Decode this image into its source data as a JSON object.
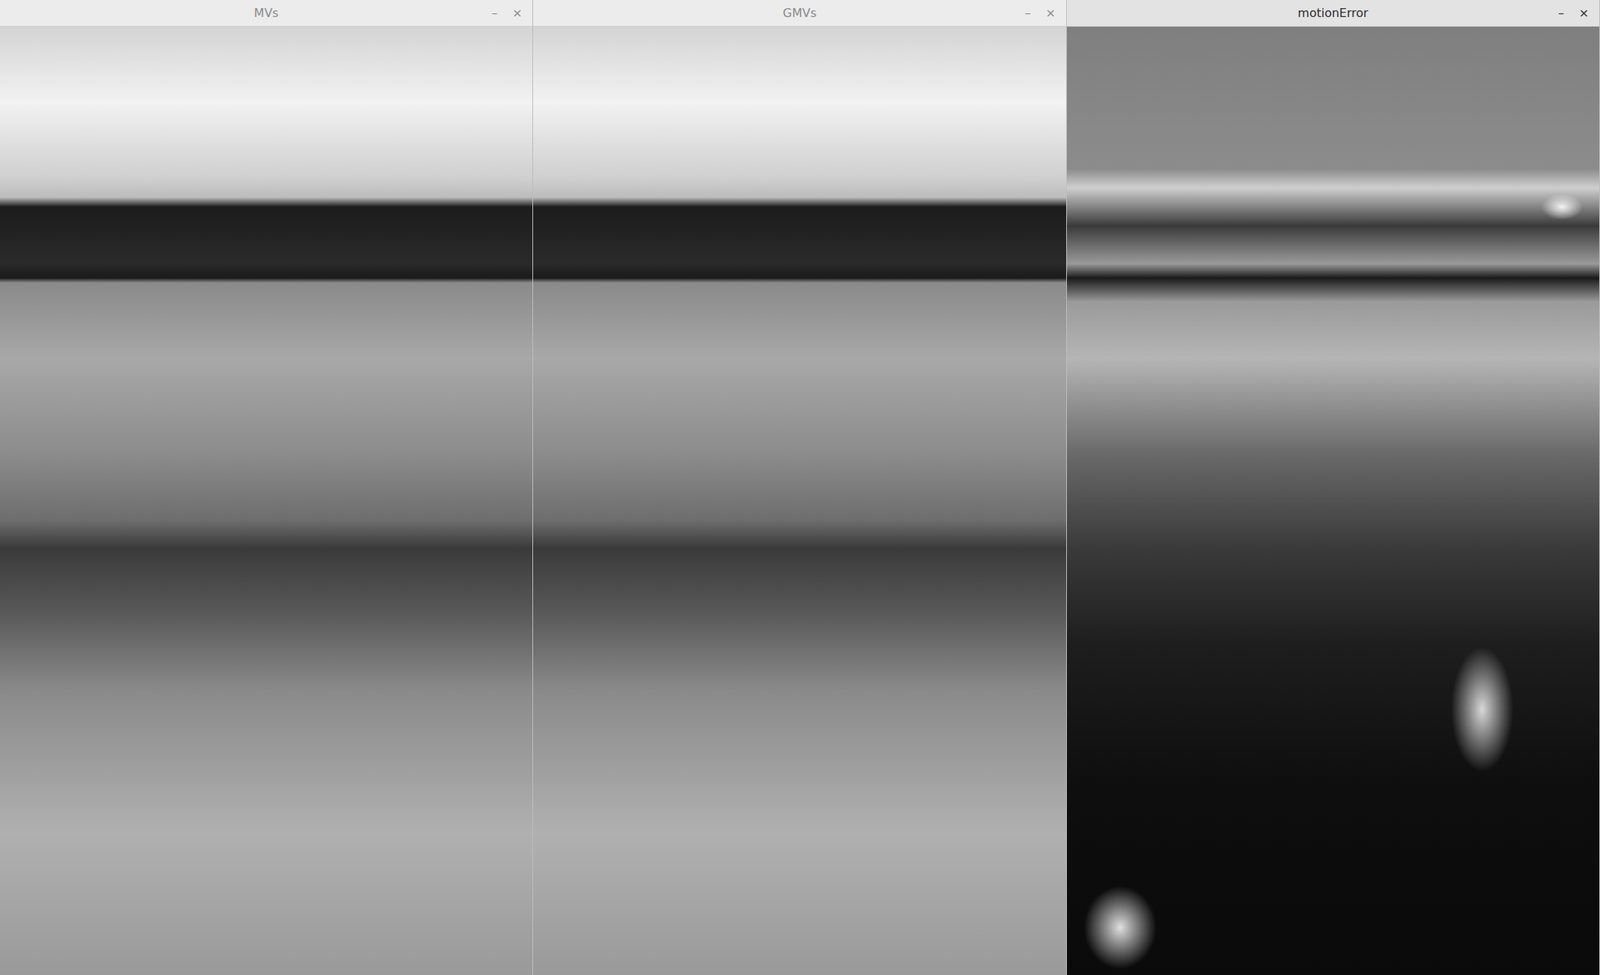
{
  "windows": [
    {
      "title": "MVs",
      "active": false,
      "kind": "photo",
      "controls": [
        "–",
        "×"
      ]
    },
    {
      "title": "GMVs",
      "active": false,
      "kind": "photo",
      "controls": [
        "–",
        "×"
      ]
    },
    {
      "title": "motionError",
      "active": true,
      "kind": "error-map",
      "controls": [
        "–",
        "×"
      ]
    }
  ]
}
